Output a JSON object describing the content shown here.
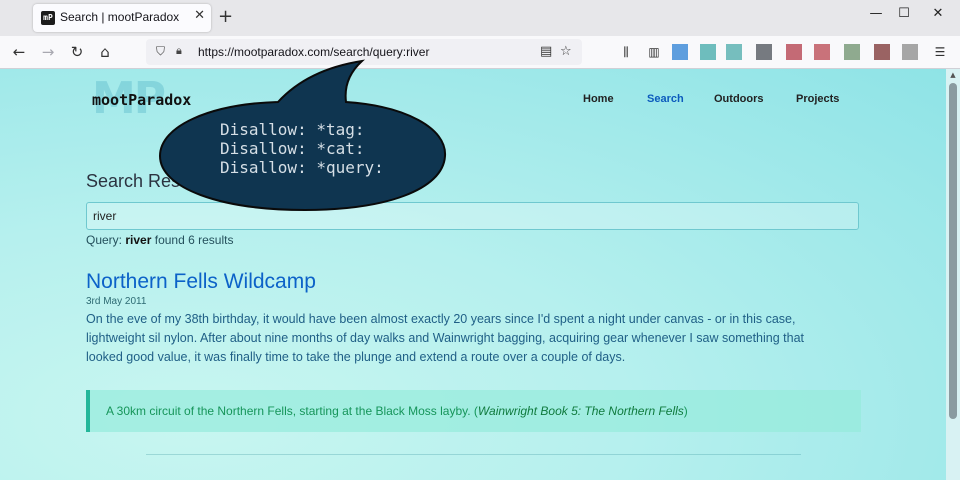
{
  "browser": {
    "tab_title": "Search | mootParadox",
    "favicon_label": "mP",
    "close_tab_glyph": "✕",
    "new_tab_glyph": "+",
    "url": "https://mootparadox.com/search/query:river",
    "window_controls": {
      "minimize": "—",
      "maximize": "☐",
      "close": "✕"
    },
    "extension_colors": [
      "#2a7fd4",
      "#3fa8a8",
      "#4aa9aa",
      "#4a4f57",
      "#b23a48",
      "#b8444f",
      "#6b8f6b",
      "#7a3030",
      "#8a8a8a"
    ]
  },
  "site": {
    "logo_text": "mootParadox",
    "logo_watermark": "MP",
    "nav": [
      "Home",
      "Search",
      "Outdoors",
      "Projects"
    ],
    "active_nav": "Search"
  },
  "search": {
    "heading": "Search Results",
    "input_value": "river",
    "query_prefix": "Query:",
    "query_term": "river",
    "query_suffix": "found 6 results"
  },
  "result": {
    "title": "Northern Fells Wildcamp",
    "date": "3rd May 2011",
    "excerpt": "On the eve of my 38th birthday, it would have been almost exactly 20 years since I'd spent a night under canvas - or in this case, lightweight sil nylon. After about nine months of day walks and Wainwright bagging, acquiring gear whenever I saw something that looked good value, it was finally time to take the plunge and extend a route over a couple of days.",
    "callout_text": "A 30km circuit of the Northern Fells, starting at the Black Moss layby. (",
    "callout_emphasis": "Wainwright Book 5: The Northern Fells",
    "callout_end": ")"
  },
  "overlay": {
    "text": "Disallow: *tag:\nDisallow: *cat:\nDisallow: *query:",
    "fill_color": "#0f3550"
  }
}
